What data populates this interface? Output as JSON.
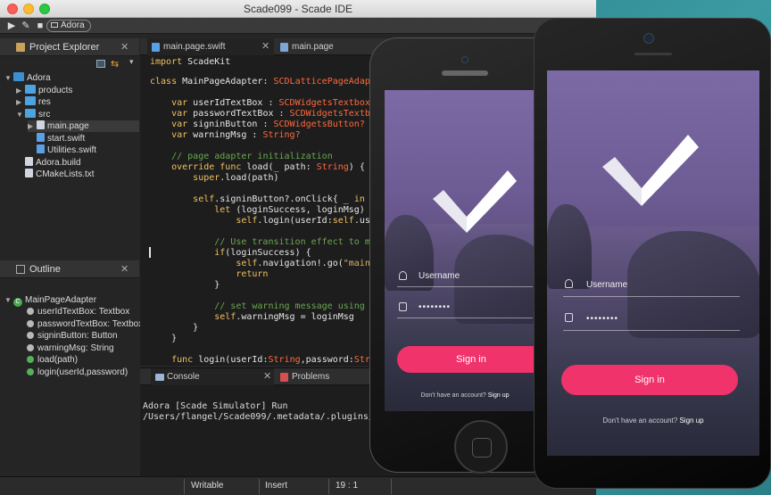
{
  "window": {
    "title": "Scade099 - Scade IDE"
  },
  "toolbar": {
    "target": "Adora"
  },
  "project_explorer": {
    "title": "Project Explorer",
    "items": [
      {
        "label": "Adora",
        "kind": "project",
        "indent": 0,
        "arrow": "▼"
      },
      {
        "label": "products",
        "kind": "folder",
        "indent": 1,
        "arrow": "▶"
      },
      {
        "label": "res",
        "kind": "folder",
        "indent": 1,
        "arrow": "▶"
      },
      {
        "label": "src",
        "kind": "folder",
        "indent": 1,
        "arrow": "▼"
      },
      {
        "label": "main.page",
        "kind": "file",
        "indent": 2,
        "arrow": "▶"
      },
      {
        "label": "start.swift",
        "kind": "swift",
        "indent": 2,
        "arrow": ""
      },
      {
        "label": "Utilities.swift",
        "kind": "swift",
        "indent": 2,
        "arrow": ""
      },
      {
        "label": "Adora.build",
        "kind": "file",
        "indent": 1,
        "arrow": ""
      },
      {
        "label": "CMakeLists.txt",
        "kind": "file",
        "indent": 1,
        "arrow": ""
      }
    ]
  },
  "outline": {
    "title": "Outline",
    "class_name": "MainPageAdapter",
    "members": [
      {
        "label": "userIdTextBox: Textbox",
        "kind": "var"
      },
      {
        "label": "passwordTextBox: Textbox",
        "kind": "var"
      },
      {
        "label": "signinButton: Button",
        "kind": "var"
      },
      {
        "label": "warningMsg: String",
        "kind": "var"
      },
      {
        "label": "load(path)",
        "kind": "method"
      },
      {
        "label": "login(userId,password)",
        "kind": "method"
      }
    ]
  },
  "editor": {
    "tabs": [
      {
        "label": "main.page.swift",
        "active": true
      },
      {
        "label": "main.page",
        "active": false
      }
    ]
  },
  "console": {
    "tabs": [
      {
        "label": "Console",
        "active": true
      },
      {
        "label": "Problems",
        "active": false
      }
    ],
    "lines": [
      "Adora [Scade Simulator] Run",
      "/Users/flangel/Scade099/.metadata/.plugins/com"
    ]
  },
  "status": {
    "mode": "Writable",
    "insert": "Insert",
    "position": "19 : 1"
  },
  "app_screen": {
    "username_placeholder": "Username",
    "password_value": "••••••••",
    "signin_label": "Sign in",
    "signup_prompt": "Don't have an account?",
    "signup_link": "Sign up"
  },
  "colors": {
    "accent_pink": "#f0336a",
    "ide_background": "#1d1d1d",
    "keyword": "#f0c060",
    "type": "#ff6a3c",
    "comment": "#6aa84f"
  }
}
